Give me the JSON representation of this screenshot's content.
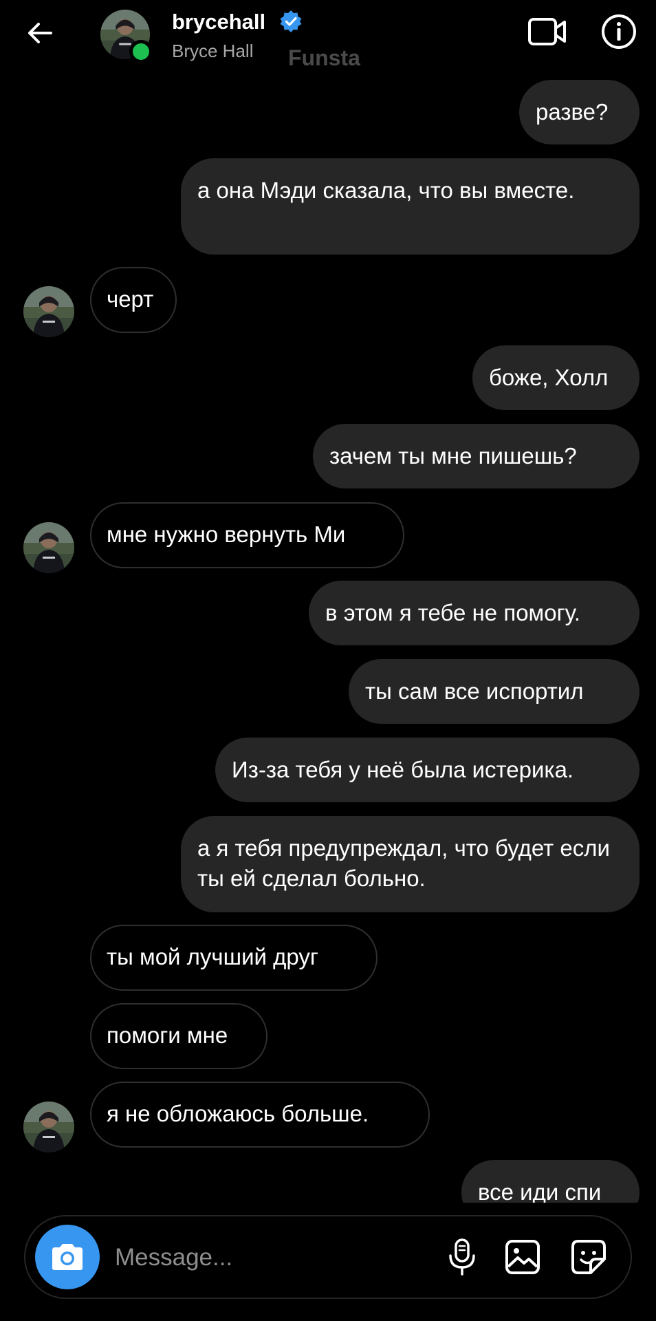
{
  "header": {
    "username": "brycehall",
    "full_name": "Bryce Hall",
    "overlay_mark": "Funsta",
    "verified": true,
    "online": true,
    "icons": {
      "back": "back-arrow-icon",
      "video_call": "video-camera-icon",
      "info": "info-icon"
    },
    "colors": {
      "verified": "#3797f0",
      "online": "#1dbf50"
    }
  },
  "messages": [
    {
      "sender": "me",
      "text": "разве?"
    },
    {
      "sender": "me",
      "text": "а она Мэди сказала, что вы вместе."
    },
    {
      "sender": "them",
      "text": "черт"
    },
    {
      "sender": "me",
      "text": "боже, Холл"
    },
    {
      "sender": "me",
      "text": "зачем ты мне пишешь?"
    },
    {
      "sender": "them",
      "text": "мне нужно вернуть Ми"
    },
    {
      "sender": "me",
      "text": "в этом я тебе не помогу."
    },
    {
      "sender": "me",
      "text": "ты сам все испортил"
    },
    {
      "sender": "me",
      "text": "Из-за тебя у неё была истерика."
    },
    {
      "sender": "me",
      "text": "а я тебя предупреждал, что будет если ты ей сделал больно."
    },
    {
      "sender": "them",
      "text": "ты мой лучший друг"
    },
    {
      "sender": "them",
      "text": "помоги мне"
    },
    {
      "sender": "them",
      "text": "я не обложаюсь больше."
    },
    {
      "sender": "me",
      "text": "все иди спи"
    }
  ],
  "composer": {
    "placeholder": "Message...",
    "icons": {
      "camera": "camera-icon",
      "mic": "microphone-icon",
      "gallery": "gallery-icon",
      "sticker": "sticker-icon"
    },
    "colors": {
      "camera_button": "#3797f0"
    }
  },
  "theme": {
    "background": "#000000",
    "outgoing_bubble": "#262626",
    "incoming_border": "#2f2f2f"
  }
}
